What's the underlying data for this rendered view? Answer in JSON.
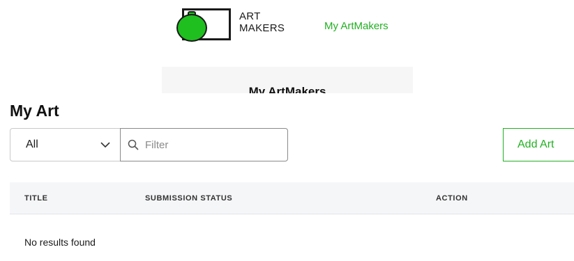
{
  "header": {
    "brand_line1": "ART",
    "brand_line2": "MAKERS",
    "nav_link": "My ArtMakers"
  },
  "banner": {
    "title": "My ArtMakers"
  },
  "page": {
    "title": "My Art"
  },
  "controls": {
    "select_value": "All",
    "filter_placeholder": "Filter",
    "filter_value": "",
    "add_button": "Add Art"
  },
  "table": {
    "columns": [
      "TITLE",
      "SUBMISSION STATUS",
      "ACTION"
    ],
    "rows": [],
    "empty_message": "No results found"
  },
  "colors": {
    "accent_green": "#22b022",
    "logo_green": "#1fbf1f"
  }
}
